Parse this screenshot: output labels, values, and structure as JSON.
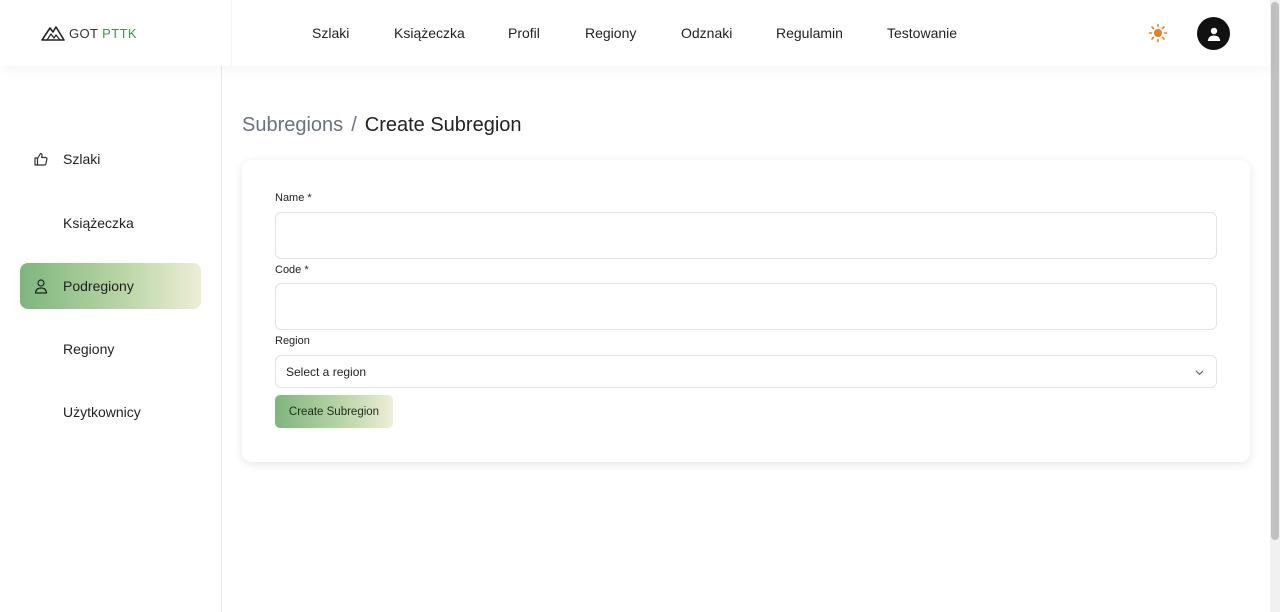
{
  "brand": {
    "name_part1": "GOT ",
    "name_part2": "PTTK"
  },
  "topnav": [
    {
      "label": "Szlaki"
    },
    {
      "label": "Książeczka"
    },
    {
      "label": "Profil"
    },
    {
      "label": "Regiony"
    },
    {
      "label": "Odznaki"
    },
    {
      "label": "Regulamin"
    },
    {
      "label": "Testowanie"
    }
  ],
  "header": {
    "theme_icon": "sun-icon",
    "account_icon": "user-icon"
  },
  "sidebar": {
    "items": [
      {
        "label": "Szlaki",
        "icon": "thumbs-up-icon",
        "active": false
      },
      {
        "label": "Książeczka",
        "icon": "",
        "active": false
      },
      {
        "label": "Podregiony",
        "icon": "user-icon",
        "active": true
      },
      {
        "label": "Regiony",
        "icon": "",
        "active": false
      },
      {
        "label": "Użytkownicy",
        "icon": "",
        "active": false
      }
    ]
  },
  "breadcrumb": {
    "parent": "Subregions",
    "separator": "/",
    "current": "Create Subregion"
  },
  "form": {
    "name": {
      "label": "Name *",
      "value": "",
      "placeholder": ""
    },
    "code": {
      "label": "Code *",
      "value": "",
      "placeholder": ""
    },
    "region": {
      "label": "Region",
      "selected": "Select a region"
    },
    "submit_label": "Create Subregion"
  },
  "colors": {
    "accent_green": "#7fb67e",
    "accent_gradient_end": "#eeeed7",
    "brand_green": "#4a8f52",
    "sun_orange": "#f07c1e"
  }
}
